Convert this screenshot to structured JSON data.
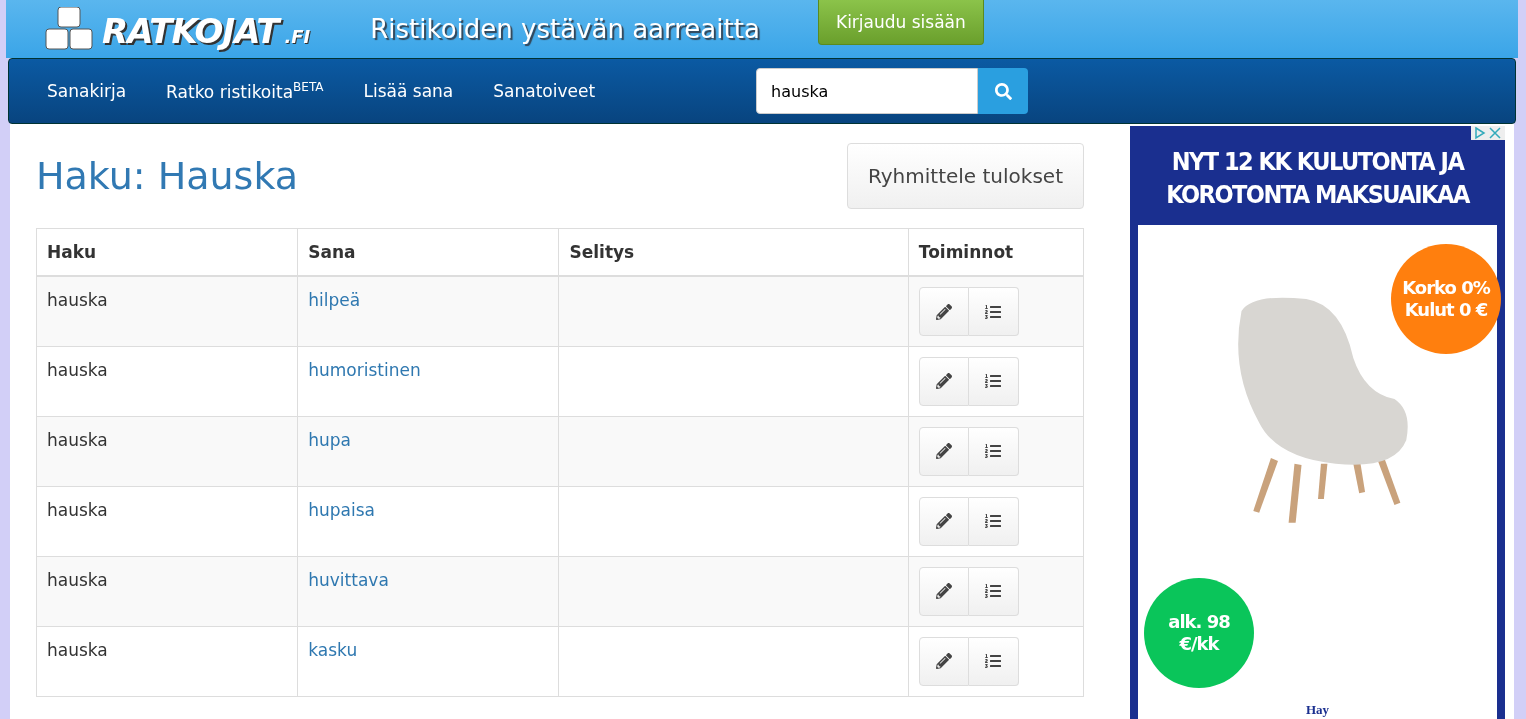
{
  "header": {
    "logo": "RATKOJAT",
    "logo_suffix": ".FI",
    "tagline": "Ristikoiden ystävän aarreaitta",
    "login_button": "Kirjaudu sisään"
  },
  "nav": {
    "items": [
      {
        "label": "Sanakirja"
      },
      {
        "label": "Ratko ristikoita",
        "sup": "BETA"
      },
      {
        "label": "Lisää sana"
      },
      {
        "label": "Sanatoiveet"
      }
    ],
    "search": {
      "value": "hauska"
    }
  },
  "page_title": "Haku: Hauska",
  "group_button": "Ryhmittele tulokset",
  "table": {
    "columns": [
      "Haku",
      "Sana",
      "Selitys",
      "Toiminnot"
    ],
    "rows": [
      {
        "haku": "hauska",
        "sana": "hilpeä"
      },
      {
        "haku": "hauska",
        "sana": "humoristinen"
      },
      {
        "haku": "hauska",
        "sana": "hupa"
      },
      {
        "haku": "hauska",
        "sana": "hupaisa"
      },
      {
        "haku": "hauska",
        "sana": "huvittava"
      },
      {
        "haku": "hauska",
        "sana": "kasku"
      }
    ]
  },
  "ad": {
    "headline": "NYT 12 KK KULUTONTA JA KOROTONTA MAKSUAIKAA",
    "badge_top": "Korko 0% Kulut 0 €",
    "badge_bottom": "alk. 98 €/kk",
    "brand": "Hay"
  }
}
